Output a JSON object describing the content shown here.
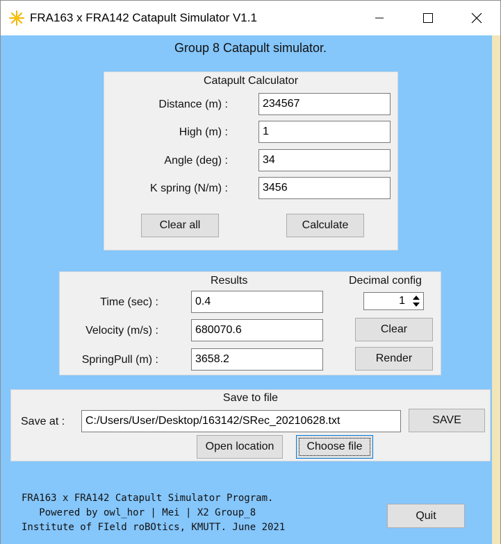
{
  "window": {
    "title": "FRA163 x FRA142 Catapult Simulator V1.1",
    "icon": "sun-app-icon",
    "controls": [
      "minimize-icon",
      "maximize-icon",
      "close-icon"
    ]
  },
  "heading": "Group 8 Catapult simulator.",
  "calculator": {
    "title": "Catapult Calculator",
    "fields": [
      {
        "label": "Distance (m)  :",
        "value": "234567"
      },
      {
        "label": "High (m)  :",
        "value": "1"
      },
      {
        "label": "Angle (deg)  :",
        "value": "34"
      },
      {
        "label": "K spring (N/m)  :",
        "value": "3456"
      }
    ],
    "clear_all_label": "Clear all",
    "calculate_label": "Calculate"
  },
  "results": {
    "title": "Results",
    "decimal_title": "Decimal config",
    "decimal_value": "1",
    "rows": [
      {
        "label": "Time (sec) :",
        "value": "0.4"
      },
      {
        "label": "Velocity (m/s)  :",
        "value": "680070.6"
      },
      {
        "label": "SpringPull (m)  :",
        "value": "3658.2"
      }
    ],
    "clear_label": "Clear",
    "render_label": "Render"
  },
  "save": {
    "title": "Save to file",
    "save_at_label": "Save at  :",
    "path": "C:/Users/User/Desktop/163142/SRec_20210628.txt",
    "save_label": "SAVE",
    "open_location_label": "Open location",
    "choose_file_label": "Choose file"
  },
  "footer": {
    "line1": "FRA163 x FRA142 Catapult Simulator Program.",
    "line2": "   Powered by owl_hor | Mei | X2 Group_8",
    "line3": "Institute of FIeld roBOtics, KMUTT. June 2021"
  },
  "quit_label": "Quit",
  "colors": {
    "client_bg": "#85c6fb",
    "panel_bg": "#f0f0f0",
    "button_bg": "#e1e1e1",
    "focus_border": "#0078d7"
  }
}
